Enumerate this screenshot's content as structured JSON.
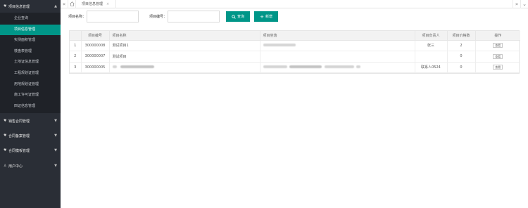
{
  "sidebar": {
    "groups": [
      {
        "label": "项目信息管理",
        "open": true
      },
      {
        "label": "销售合同管理"
      },
      {
        "label": "合同备案管理"
      },
      {
        "label": "合同模板管理"
      },
      {
        "label": "用户中心"
      }
    ],
    "items": [
      {
        "label": "企业查询"
      },
      {
        "label": "项目信息管理",
        "active": true
      },
      {
        "label": "实测面积管理"
      },
      {
        "label": "楼盘表管理"
      },
      {
        "label": "土地证信息管理"
      },
      {
        "label": "工程规划证管理"
      },
      {
        "label": "用地规划证管理"
      },
      {
        "label": "施工许可证管理"
      },
      {
        "label": "四证信息管理"
      }
    ]
  },
  "topbar": {
    "collapse_left": "«",
    "home_icon": "home-icon",
    "tab_label": "项目信息管理",
    "tab_close": "×",
    "collapse_right": "»",
    "dropdown": "⌄"
  },
  "search": {
    "name_label": "项目名称：",
    "name_value": "",
    "code_label": "项目编号：",
    "code_value": "",
    "query_button": "查询",
    "add_button": "新增"
  },
  "table": {
    "columns": [
      "",
      "项目编号",
      "项目名称",
      "项目坐落",
      "项目负责人",
      "项目价格数",
      "操作"
    ],
    "rows": [
      {
        "index": "1",
        "code": "300000008",
        "name": "测试项目1",
        "address_redacted": true,
        "manager": "张三",
        "count": "2",
        "action": "查看"
      },
      {
        "index": "2",
        "code": "300000007",
        "name": "测试项目",
        "address_redacted": false,
        "manager": "",
        "count": "0",
        "action": "查看"
      },
      {
        "index": "3",
        "code": "300000005",
        "name_redacted": true,
        "address_redacted": true,
        "manager": "联系人0524",
        "count": "0",
        "action": "查看"
      }
    ]
  },
  "colors": {
    "accent": "#009688",
    "sidebar_bg": "#2a2e36",
    "sidebar_sub_bg": "#1f2228"
  }
}
